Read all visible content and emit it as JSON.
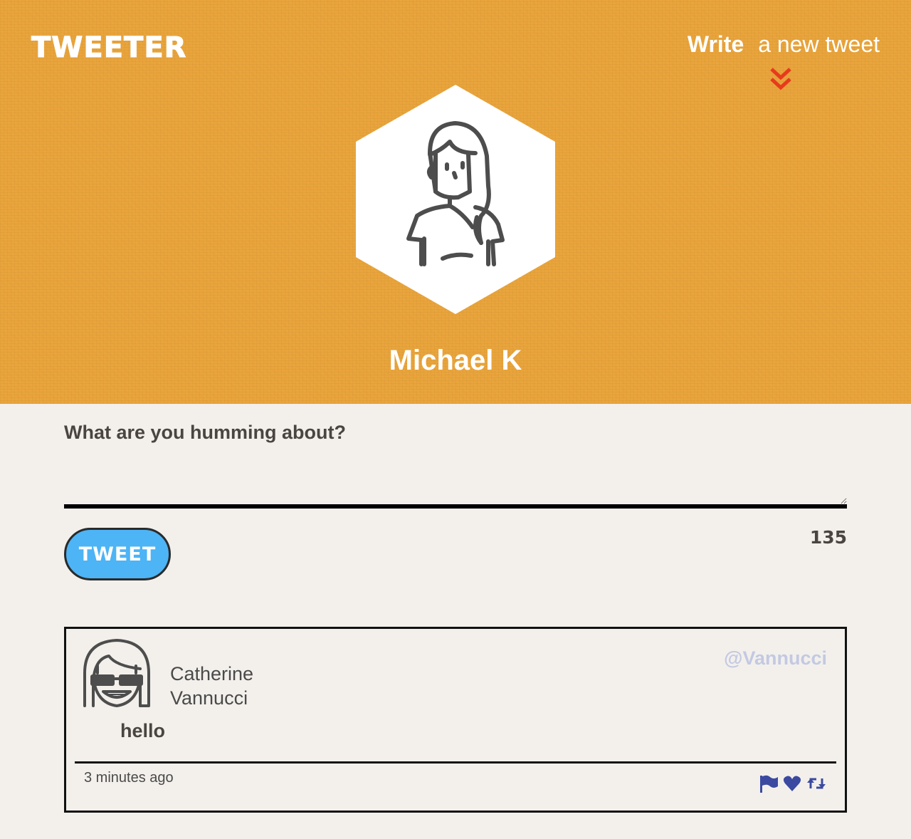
{
  "header": {
    "logo": "TWEETER",
    "nav_write_strong": "Write",
    "nav_write_light": "a new tweet",
    "profile_name": "Michael K"
  },
  "compose": {
    "label": "What are you humming about?",
    "textarea_value": "",
    "button_label": "TWEET",
    "char_counter": "135"
  },
  "tweets": [
    {
      "name": "Catherine Vannucci",
      "handle": "@Vannucci",
      "content": "hello",
      "time": "3 minutes ago"
    }
  ],
  "colors": {
    "header_bg": "#e9a43b",
    "page_bg": "#f3f0ec",
    "tweet_button": "#4db4f5",
    "chevron": "#e83a1c",
    "action_icons": "#3b4aa0",
    "handle": "#c3c9e2"
  },
  "icons": {
    "nav": "chevron-double-down-icon",
    "tweet_actions": [
      "flag-icon",
      "heart-icon",
      "retweet-icon"
    ]
  }
}
